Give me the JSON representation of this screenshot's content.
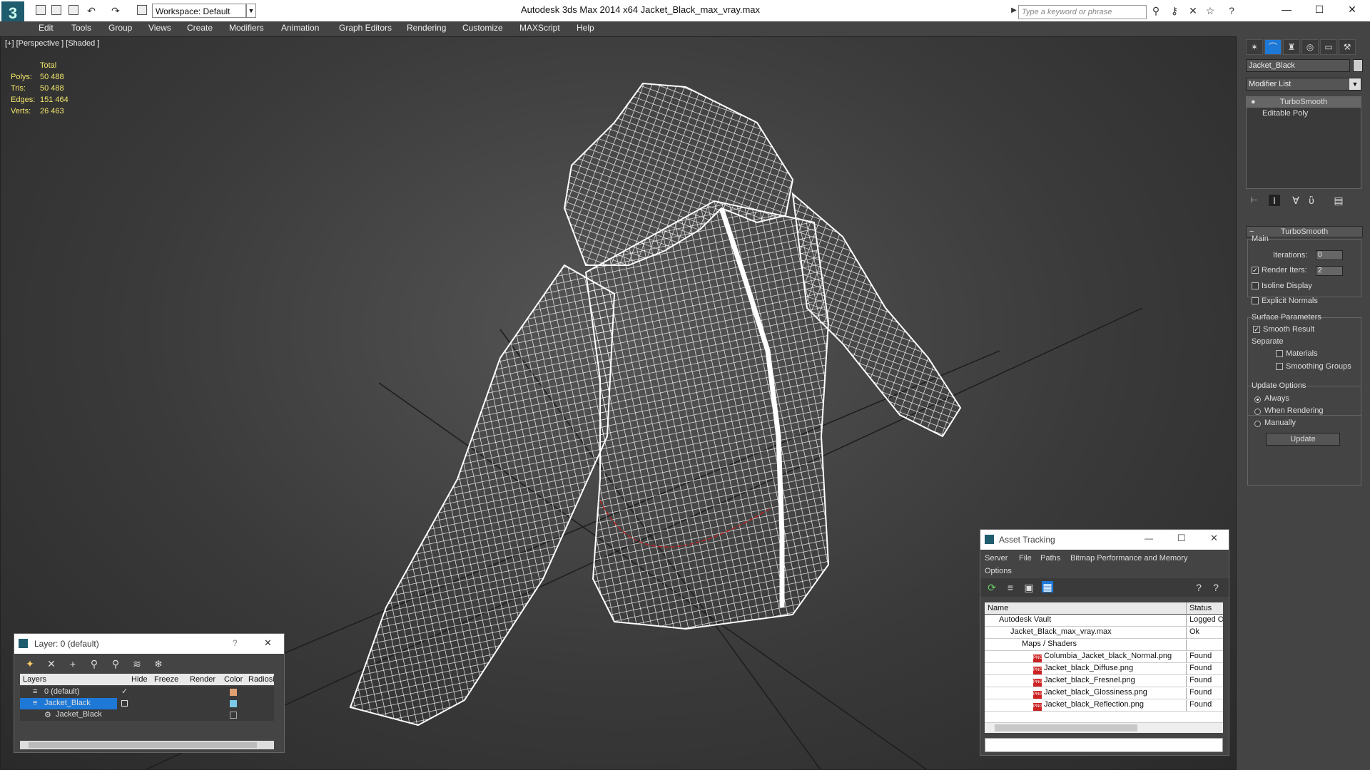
{
  "app": {
    "title": "Autodesk 3ds Max  2014 x64      Jacket_Black_max_vray.max",
    "workspace": "Workspace: Default",
    "search_placeholder": "Type a keyword or phrase"
  },
  "menu": [
    "Edit",
    "Tools",
    "Group",
    "Views",
    "Create",
    "Modifiers",
    "Animation",
    "Graph Editors",
    "Rendering",
    "Customize",
    "MAXScript",
    "Help"
  ],
  "viewport": {
    "label": "[+] [Perspective ] [Shaded ]",
    "stats_header": "Total",
    "stats": [
      {
        "k": "Polys:",
        "v": "50 488"
      },
      {
        "k": "Tris:",
        "v": "50 488"
      },
      {
        "k": "Edges:",
        "v": "151 464"
      },
      {
        "k": "Verts:",
        "v": "26 463"
      }
    ]
  },
  "command_panel": {
    "object_name": "Jacket_Black",
    "modifier_list": "Modifier List",
    "stack": [
      "TurboSmooth",
      "Editable Poly"
    ],
    "rollout_title": "TurboSmooth",
    "main_label": "Main",
    "iterations_label": "Iterations:",
    "iterations_value": "0",
    "render_iters_label": "Render Iters:",
    "render_iters_value": "2",
    "isoline": "Isoline Display",
    "explicit_normals": "Explicit Normals",
    "surface_params": "Surface Parameters",
    "smooth_result": "Smooth Result",
    "separate": "Separate",
    "materials": "Materials",
    "smoothing_groups": "Smoothing Groups",
    "update_options": "Update Options",
    "always": "Always",
    "when_rendering": "When Rendering",
    "manually": "Manually",
    "update_button": "Update"
  },
  "asset_tracking": {
    "title": "Asset Tracking",
    "menu": [
      "Server",
      "File",
      "Paths",
      "Bitmap Performance and Memory"
    ],
    "options": "Options",
    "col_name": "Name",
    "col_status": "Status",
    "rows": [
      {
        "name": "Autodesk Vault",
        "status": "Logged Out"
      },
      {
        "name": "Jacket_Black_max_vray.max",
        "status": "Ok"
      },
      {
        "name": "Maps / Shaders",
        "status": ""
      },
      {
        "name": "Columbia_Jacket_black_Normal.png",
        "status": "Found"
      },
      {
        "name": "Jacket_black_Diffuse.png",
        "status": "Found"
      },
      {
        "name": "Jacket_black_Fresnel.png",
        "status": "Found"
      },
      {
        "name": "Jacket_black_Glossiness.png",
        "status": "Found"
      },
      {
        "name": "Jacket_black_Reflection.png",
        "status": "Found"
      }
    ]
  },
  "layer_dialog": {
    "title": "Layer: 0 (default)",
    "help": "?",
    "columns": [
      "Layers",
      "Hide",
      "Freeze",
      "Render",
      "Color",
      "Radiosi"
    ],
    "rows": [
      {
        "name": "0 (default)"
      },
      {
        "name": "Jacket_Black"
      },
      {
        "name": "Jacket_Black"
      }
    ]
  },
  "colors": {
    "accent_selected": "#1e78d6",
    "stats_yellow": "#f2e66a",
    "panel": "#444444"
  }
}
